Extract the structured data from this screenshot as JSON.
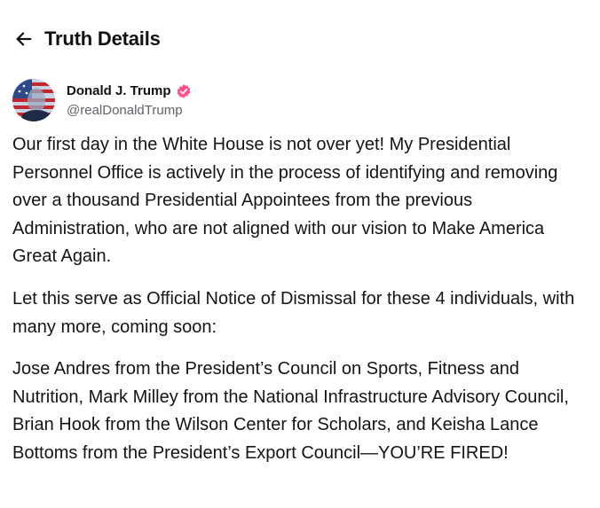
{
  "header": {
    "title": "Truth Details",
    "back_icon": "arrow-left-icon"
  },
  "author": {
    "name": "Donald J. Trump",
    "handle": "@realDonaldTrump",
    "verified_icon": "verified-badge-icon",
    "verified_color": "#ff4d8d"
  },
  "post": {
    "paragraphs": [
      "Our first day in the White House is not over yet! My Presidential Personnel Office is actively in the process of identifying and removing over a thousand Presidential Appointees from the previous Administration, who are not aligned with our vision to Make America Great Again.",
      "Let this serve as Official Notice of Dismissal for these 4 individuals, with many more, coming soon:",
      "Jose Andres from the President’s Council on Sports, Fitness and Nutrition, Mark Milley from the National Infrastructure Advisory Council, Brian Hook from the Wilson Center for Scholars, and Keisha Lance Bottoms from the President’s Export Council—YOU’RE FIRED!"
    ]
  }
}
